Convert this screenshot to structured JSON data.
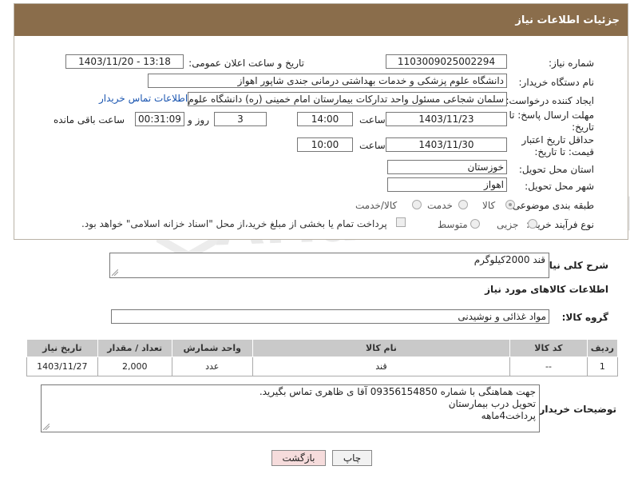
{
  "panel": {
    "title": "جزئیات اطلاعات نیاز"
  },
  "form": {
    "need_number_label": "شماره نیاز:",
    "need_number": "1103009025002294",
    "announce_label": "تاریخ و ساعت اعلان عمومی:",
    "announce_value": "1403/11/20 - 13:18",
    "buyer_org_label": "نام دستگاه خریدار:",
    "buyer_org": "دانشگاه علوم پزشکی و خدمات بهداشتی درمانی جندی شاپور اهواز",
    "requester_label": "ایجاد کننده درخواست:",
    "requester": "سلمان شجاعی مسئول واحد تدارکات بیمارستان امام خمینی (ره) دانشگاه علوم",
    "buyer_contact_link": "اطلاعات تماس خریدار",
    "deadline_label": "مهلت ارسال پاسخ: تا تاریخ:",
    "deadline_date": "1403/11/23",
    "time_word": "ساعت",
    "deadline_time": "14:00",
    "days_value": "3",
    "days_word": "روز و",
    "remaining_time": "00:31:09",
    "remaining_word": "ساعت باقی مانده",
    "validity_label": "حداقل تاریخ اعتبار قیمت: تا تاریخ:",
    "validity_date": "1403/11/30",
    "validity_time": "10:00",
    "province_label": "استان محل تحویل:",
    "province": "خوزستان",
    "city_label": "شهر محل تحویل:",
    "city": "اهواز",
    "category_label": "طبقه بندی موضوعی:",
    "category_options": [
      "کالا",
      "خدمت",
      "کالا/خدمت"
    ],
    "process_label": "نوع فرآیند خرید :",
    "process_options": [
      "جزیی",
      "متوسط"
    ],
    "payment_note": "پرداخت تمام یا بخشی از مبلغ خرید،از محل \"اسناد خزانه اسلامی\" خواهد بود."
  },
  "description": {
    "label": "شرح کلی نیاز:",
    "value": "قند 2000کیلوگرم"
  },
  "goods_section_title": "اطلاعات کالاهای مورد نیاز",
  "goods_group": {
    "label": "گروه کالا:",
    "value": "مواد غذائی و نوشیدنی"
  },
  "table": {
    "headers": [
      "ردیف",
      "کد کالا",
      "نام کالا",
      "واحد شمارش",
      "تعداد / مقدار",
      "تاریخ نیاز"
    ],
    "rows": [
      [
        "1",
        "--",
        "قند",
        "عدد",
        "2,000",
        "1403/11/27"
      ]
    ]
  },
  "buyer_notes": {
    "label": "توضیحات خریدار:",
    "lines": [
      "جهت هماهنگی با شماره 09356154850 آقا ی ظاهری تماس بگیرید.",
      "تحویل درب بیمارستان",
      "پرداخت4ماهه"
    ]
  },
  "buttons": {
    "print": "چاپ",
    "back": "بازگشت"
  },
  "watermark": {
    "text": "AriaTender.neT"
  },
  "colors": {
    "header_bg": "#8a6d4b",
    "link": "#1a55b0",
    "back_button_bg": "#f6dcdc"
  }
}
